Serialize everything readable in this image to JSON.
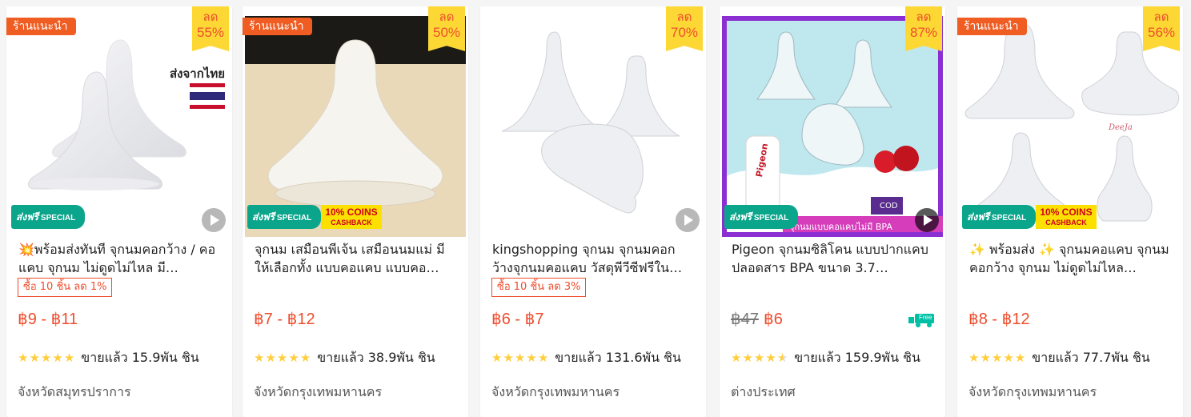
{
  "badges": {
    "recommend": "ร้านแนะนำ",
    "discount_label": "ลด",
    "freeship_main": "ส่งฟรี",
    "freeship_tag": "SPECIAL",
    "coins_line1": "10% COINS",
    "coins_line2": "CASHBACK",
    "truck_free": "Free"
  },
  "colors": {
    "accent": "#ee4d2d",
    "badge_orange": "#f05d23",
    "discount_yellow": "#fdd835",
    "freeship_green": "#0aa58b",
    "star": "#ffce3d"
  },
  "products": [
    {
      "image_text": "ส่งจากไทย",
      "discount": "55%",
      "title": "💥พร้อมส่งทันที จุกนมคอกว้าง / คอแคบ จุกนม ไม่ดูดไม่ไหล มี…",
      "promo": "ซื้อ 10 ชิ้น ลด 1%",
      "price": "฿9 - ฿11",
      "rating": 5,
      "sold": "ขายแล้ว 15.9พัน ชิน",
      "location": "จังหวัดสมุทรปราการ"
    },
    {
      "discount": "50%",
      "title": "จุกนม เสมือนพีเจ้น เสมือนนมแม่ มีให้เลือกทั้ง แบบคอแคบ แบบคอ…",
      "price": "฿7 - ฿12",
      "rating": 5,
      "sold": "ขายแล้ว 38.9พัน ชิน",
      "location": "จังหวัดกรุงเทพมหานคร"
    },
    {
      "discount": "70%",
      "title": "kingshopping จุกนม จุกนมคอกว้างจุกนมคอแคบ วัสดุพีวีซีฟรีใน…",
      "promo": "ซื้อ 10 ชิ้น ลด 3%",
      "price": "฿6 - ฿7",
      "rating": 5,
      "sold": "ขายแล้ว 131.6พัน ชิน",
      "location": "จังหวัดกรุงเทพมหานคร"
    },
    {
      "discount": "87%",
      "image_text": "จุกนมแบบคอแคบไม่มี BPA",
      "image_brand": "Pigeon",
      "image_cod": "COD",
      "title": "Pigeon จุกนมซิลิโคน แบบปากแคบ ปลอดสาร BPA ขนาด 3.7…",
      "price_old": "฿47",
      "price": "฿6",
      "rating": 4.5,
      "sold": "ขายแล้ว 159.9พัน ชิน",
      "location": "ต่างประเทศ"
    },
    {
      "discount": "56%",
      "image_watermark": "DeeJa",
      "title": "✨ พร้อมส่ง ✨ จุกนมคอแคบ จุกนมคอกว้าง จุกนม ไม่ดูดไม่ไหล…",
      "price": "฿8 - ฿12",
      "rating": 5,
      "sold": "ขายแล้ว 77.7พัน ชิน",
      "location": "จังหวัดกรุงเทพมหานคร"
    }
  ]
}
